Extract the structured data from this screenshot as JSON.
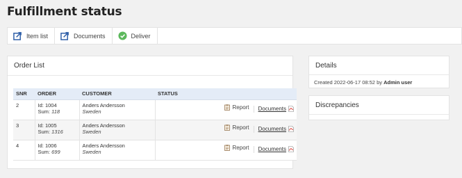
{
  "page": {
    "title": "Fulfillment status"
  },
  "toolbar": {
    "item_list": "Item list",
    "documents": "Documents",
    "deliver": "Deliver"
  },
  "orders": {
    "title": "Order List",
    "columns": {
      "snr": "SNR",
      "order": "ORDER",
      "customer": "CUSTOMER",
      "status": "STATUS"
    },
    "id_label": "Id:",
    "sum_label": "Sum:",
    "report_label": "Report",
    "documents_label": "Documents",
    "rows": [
      {
        "snr": "2",
        "id": "1004",
        "sum": "118",
        "name": "Anders Andersson",
        "country": "Sweden"
      },
      {
        "snr": "3",
        "id": "1005",
        "sum": "1316",
        "name": "Anders Andersson",
        "country": "Sweden"
      },
      {
        "snr": "4",
        "id": "1006",
        "sum": "699",
        "name": "Anders Andersson",
        "country": "Sweden"
      }
    ]
  },
  "details": {
    "title": "Details",
    "created_prefix": "Created 2022-06-17 08:52 by",
    "created_by": "Admin user"
  },
  "discrepancies": {
    "title": "Discrepancies"
  },
  "icons": {
    "item_list": "export-icon",
    "documents": "export-icon",
    "deliver": "check-circle-icon",
    "report": "clipboard-icon",
    "pdf": "pdf-file-icon"
  },
  "colors": {
    "export_icon": "#2f5fa8",
    "deliver_icon": "#5cb85c",
    "table_header_bg": "#e4ecf7",
    "pdf_red": "#d9342b"
  }
}
